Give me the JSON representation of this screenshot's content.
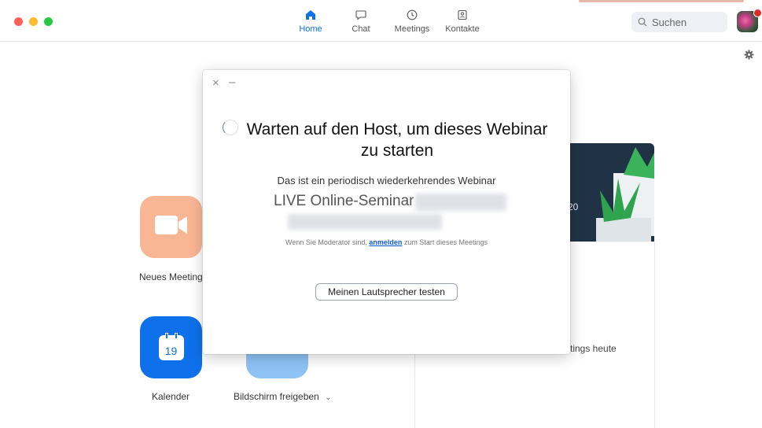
{
  "topbar": {
    "tabs": [
      {
        "label": "Home",
        "icon": "home-icon",
        "active": true
      },
      {
        "label": "Chat",
        "icon": "chat-icon",
        "active": false
      },
      {
        "label": "Meetings",
        "icon": "clock-icon",
        "active": false
      },
      {
        "label": "Kontakte",
        "icon": "contacts-icon",
        "active": false
      }
    ],
    "search_placeholder": "Suchen"
  },
  "home": {
    "new_meeting_label": "Neues Meeting",
    "calendar_label": "Kalender",
    "calendar_day": "19",
    "share_screen_label": "Bildschirm freigeben",
    "share_chevron": "⌄",
    "card_partial_text": "20",
    "meetings_today_partial": "tings heute"
  },
  "modal": {
    "close_glyph": "×",
    "minimize_glyph": "–",
    "title": "Warten auf den Host, um dieses Webinar zu starten",
    "subtitle": "Das ist ein periodisch wiederkehrendes Webinar",
    "webinar_name": "LIVE Online-Seminar",
    "hint_before": "Wenn Sie Moderator sind, ",
    "hint_link": "anmelden",
    "hint_after": " zum Start dieses Meetings",
    "test_speaker_button": "Meinen Lautsprecher testen"
  },
  "colors": {
    "accent": "#0e71eb",
    "new_meeting": "#f9b694",
    "calendar": "#0e71eb",
    "share": "#8fc3f5"
  }
}
